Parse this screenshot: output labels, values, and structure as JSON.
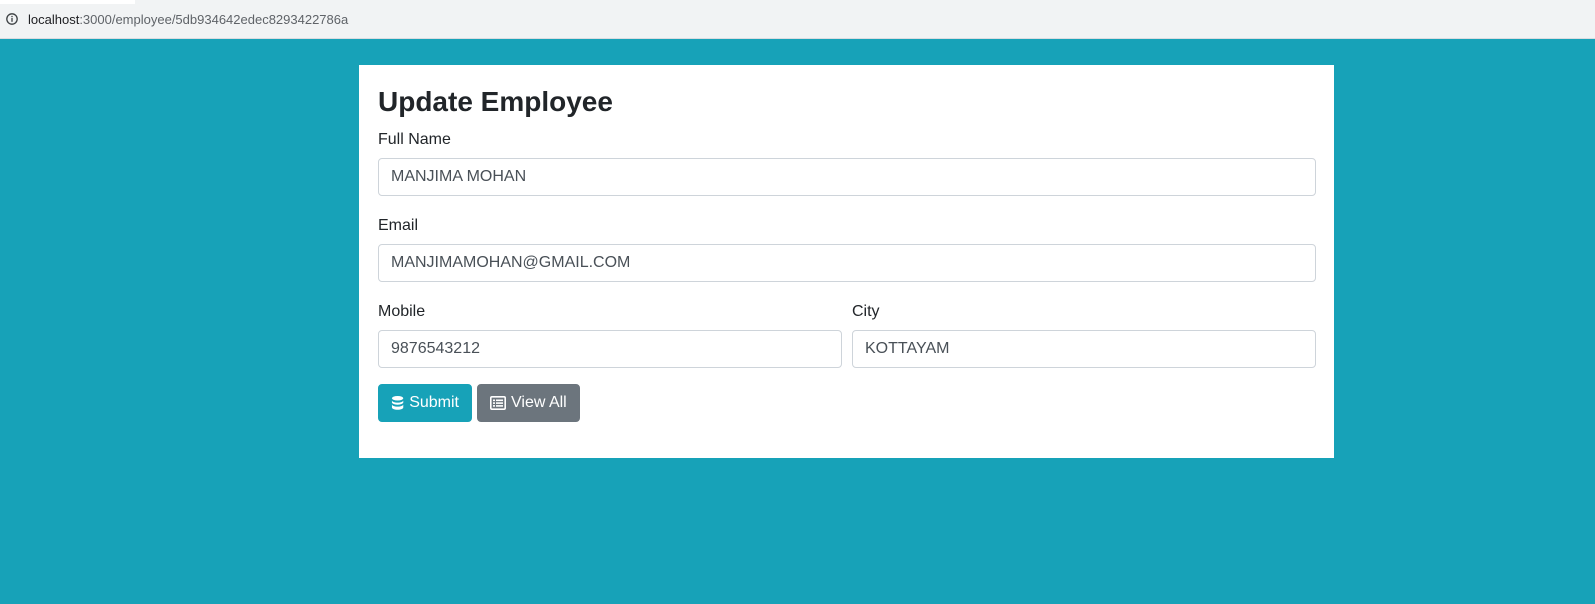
{
  "browser": {
    "url_host": "localhost",
    "url_path": ":3000/employee/5db934642edec8293422786a"
  },
  "form": {
    "title": "Update Employee",
    "fullname_label": "Full Name",
    "fullname_value": "MANJIMA MOHAN",
    "email_label": "Email",
    "email_value": "MANJIMAMOHAN@GMAIL.COM",
    "mobile_label": "Mobile",
    "mobile_value": "9876543212",
    "city_label": "City",
    "city_value": "KOTTAYAM",
    "submit_label": "Submit",
    "view_all_label": "View All"
  },
  "icons": {
    "info": "info-icon",
    "submit": "database-icon",
    "view_all": "list-alt-icon"
  },
  "colors": {
    "background": "#17a2b8",
    "submit_button": "#17a2b8",
    "view_all_button": "#6c757d"
  }
}
